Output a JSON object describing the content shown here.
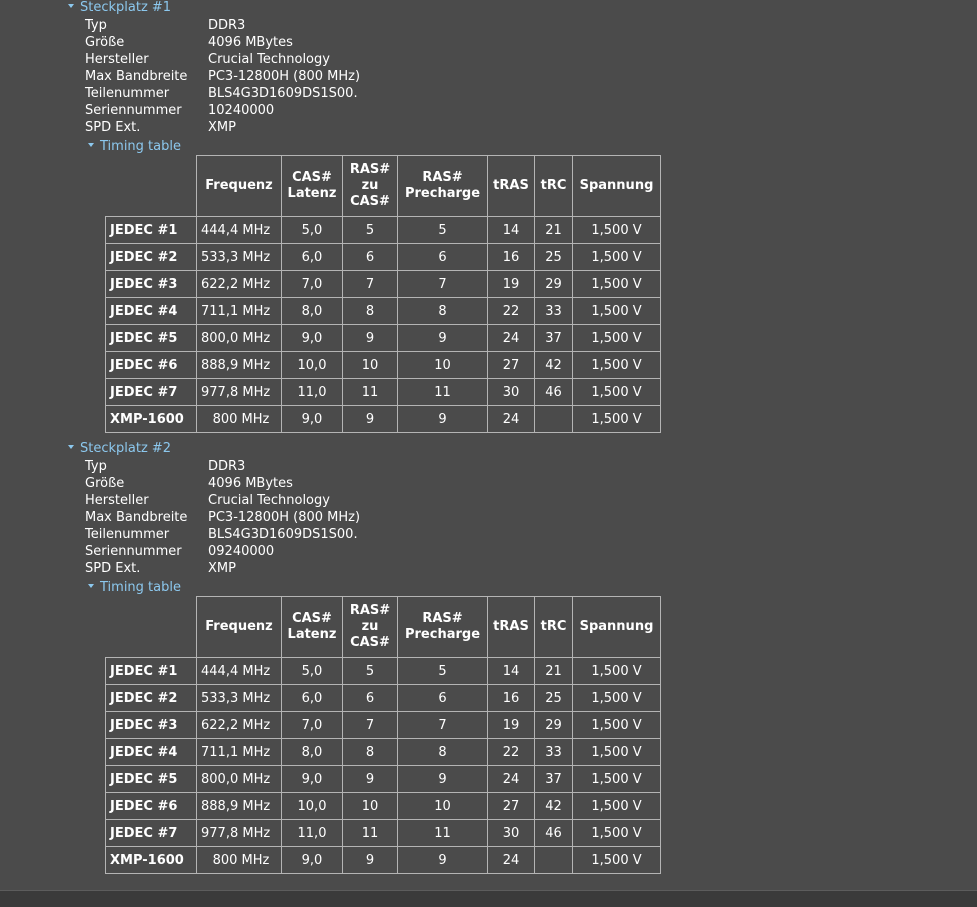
{
  "slots": [
    {
      "title": "Steckplatz #1",
      "props": [
        {
          "key": "Typ",
          "value": "DDR3"
        },
        {
          "key": "Größe",
          "value": "4096 MBytes"
        },
        {
          "key": "Hersteller",
          "value": "Crucial Technology"
        },
        {
          "key": "Max Bandbreite",
          "value": "PC3-12800H (800 MHz)"
        },
        {
          "key": "Teilenummer",
          "value": "BLS4G3D1609DS1S00."
        },
        {
          "key": "Seriennummer",
          "value": "10240000"
        },
        {
          "key": "SPD Ext.",
          "value": "XMP"
        }
      ],
      "timing_title": "Timing table",
      "rows": [
        {
          "name": "JEDEC #1",
          "freq": "444,4 MHz",
          "cas": "5,0",
          "rcd": "5",
          "rp": "5",
          "tras": "14",
          "trc": "21",
          "volt": "1,500 V"
        },
        {
          "name": "JEDEC #2",
          "freq": "533,3 MHz",
          "cas": "6,0",
          "rcd": "6",
          "rp": "6",
          "tras": "16",
          "trc": "25",
          "volt": "1,500 V"
        },
        {
          "name": "JEDEC #3",
          "freq": "622,2 MHz",
          "cas": "7,0",
          "rcd": "7",
          "rp": "7",
          "tras": "19",
          "trc": "29",
          "volt": "1,500 V"
        },
        {
          "name": "JEDEC #4",
          "freq": "711,1 MHz",
          "cas": "8,0",
          "rcd": "8",
          "rp": "8",
          "tras": "22",
          "trc": "33",
          "volt": "1,500 V"
        },
        {
          "name": "JEDEC #5",
          "freq": "800,0 MHz",
          "cas": "9,0",
          "rcd": "9",
          "rp": "9",
          "tras": "24",
          "trc": "37",
          "volt": "1,500 V"
        },
        {
          "name": "JEDEC #6",
          "freq": "888,9 MHz",
          "cas": "10,0",
          "rcd": "10",
          "rp": "10",
          "tras": "27",
          "trc": "42",
          "volt": "1,500 V"
        },
        {
          "name": "JEDEC #7",
          "freq": "977,8 MHz",
          "cas": "11,0",
          "rcd": "11",
          "rp": "11",
          "tras": "30",
          "trc": "46",
          "volt": "1,500 V"
        },
        {
          "name": "XMP-1600",
          "freq": "800 MHz",
          "cas": "9,0",
          "rcd": "9",
          "rp": "9",
          "tras": "24",
          "trc": "",
          "volt": "1,500 V"
        }
      ]
    },
    {
      "title": "Steckplatz #2",
      "props": [
        {
          "key": "Typ",
          "value": "DDR3"
        },
        {
          "key": "Größe",
          "value": "4096 MBytes"
        },
        {
          "key": "Hersteller",
          "value": "Crucial Technology"
        },
        {
          "key": "Max Bandbreite",
          "value": "PC3-12800H (800 MHz)"
        },
        {
          "key": "Teilenummer",
          "value": "BLS4G3D1609DS1S00."
        },
        {
          "key": "Seriennummer",
          "value": "09240000"
        },
        {
          "key": "SPD Ext.",
          "value": "XMP"
        }
      ],
      "timing_title": "Timing table",
      "rows": [
        {
          "name": "JEDEC #1",
          "freq": "444,4 MHz",
          "cas": "5,0",
          "rcd": "5",
          "rp": "5",
          "tras": "14",
          "trc": "21",
          "volt": "1,500 V"
        },
        {
          "name": "JEDEC #2",
          "freq": "533,3 MHz",
          "cas": "6,0",
          "rcd": "6",
          "rp": "6",
          "tras": "16",
          "trc": "25",
          "volt": "1,500 V"
        },
        {
          "name": "JEDEC #3",
          "freq": "622,2 MHz",
          "cas": "7,0",
          "rcd": "7",
          "rp": "7",
          "tras": "19",
          "trc": "29",
          "volt": "1,500 V"
        },
        {
          "name": "JEDEC #4",
          "freq": "711,1 MHz",
          "cas": "8,0",
          "rcd": "8",
          "rp": "8",
          "tras": "22",
          "trc": "33",
          "volt": "1,500 V"
        },
        {
          "name": "JEDEC #5",
          "freq": "800,0 MHz",
          "cas": "9,0",
          "rcd": "9",
          "rp": "9",
          "tras": "24",
          "trc": "37",
          "volt": "1,500 V"
        },
        {
          "name": "JEDEC #6",
          "freq": "888,9 MHz",
          "cas": "10,0",
          "rcd": "10",
          "rp": "10",
          "tras": "27",
          "trc": "42",
          "volt": "1,500 V"
        },
        {
          "name": "JEDEC #7",
          "freq": "977,8 MHz",
          "cas": "11,0",
          "rcd": "11",
          "rp": "11",
          "tras": "30",
          "trc": "46",
          "volt": "1,500 V"
        },
        {
          "name": "XMP-1600",
          "freq": "800 MHz",
          "cas": "9,0",
          "rcd": "9",
          "rp": "9",
          "tras": "24",
          "trc": "",
          "volt": "1,500 V"
        }
      ]
    }
  ],
  "table_headers": {
    "freq": "Frequenz",
    "cas_1": "CAS#",
    "cas_2": "Latenz",
    "rcd_1": "RAS#",
    "rcd_2": "zu",
    "rcd_3": "CAS#",
    "rp_1": "RAS#",
    "rp_2": "Precharge",
    "tras": "tRAS",
    "trc": "tRC",
    "volt": "Spannung"
  },
  "icons": {
    "expand": "caret-down-icon"
  }
}
